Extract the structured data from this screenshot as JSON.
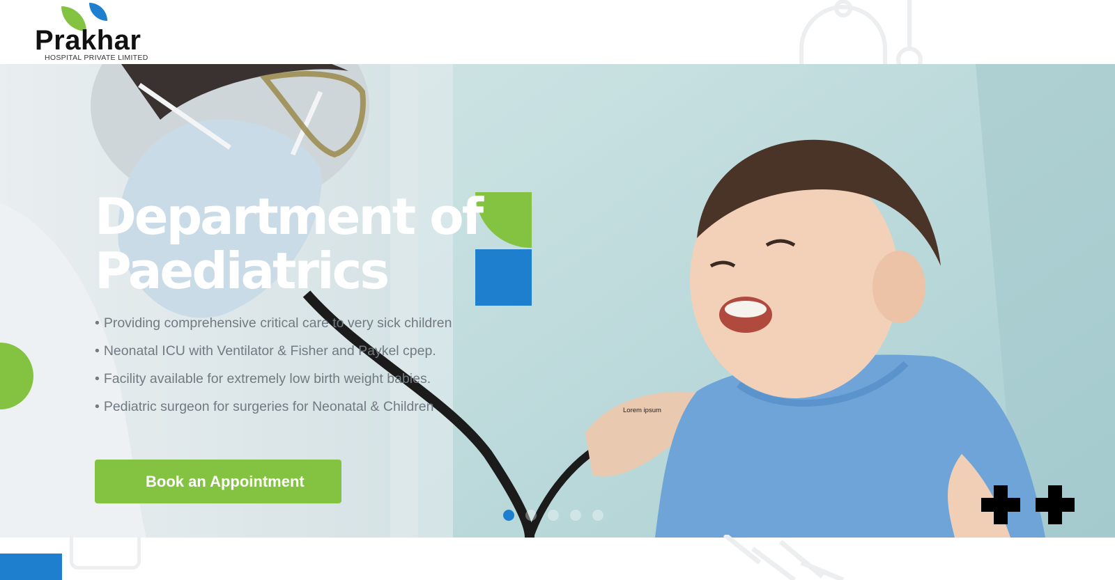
{
  "header": {
    "logo": {
      "name": "Prakhar",
      "subtitle": "HOSPITAL PRIVATE LIMITED"
    }
  },
  "hero": {
    "title_line1": "Department of",
    "title_line2": "Paediatrics",
    "bullets": [
      "Providing comprehensive critical care to very sick children",
      "Neonatal ICU with Ventilator & Fisher and Paykel cpep.",
      "Facility available for extremely low birth weight babies.",
      "Pediatric surgeon for surgeries for Neonatal & Children"
    ],
    "bullet_char": "•",
    "cta_label": "Book an Appointment",
    "caption": "Lorem ipsum",
    "slider": {
      "total": 5,
      "active": 1
    }
  },
  "colors": {
    "brand_green": "#84c341",
    "brand_blue": "#1e7fce",
    "title_text": "#ffffff",
    "bullet_text": "#707a80"
  },
  "icons": [
    "stethoscope-outline-icon",
    "plus-icon",
    "syringe-outline-icon",
    "bed-outline-icon"
  ]
}
